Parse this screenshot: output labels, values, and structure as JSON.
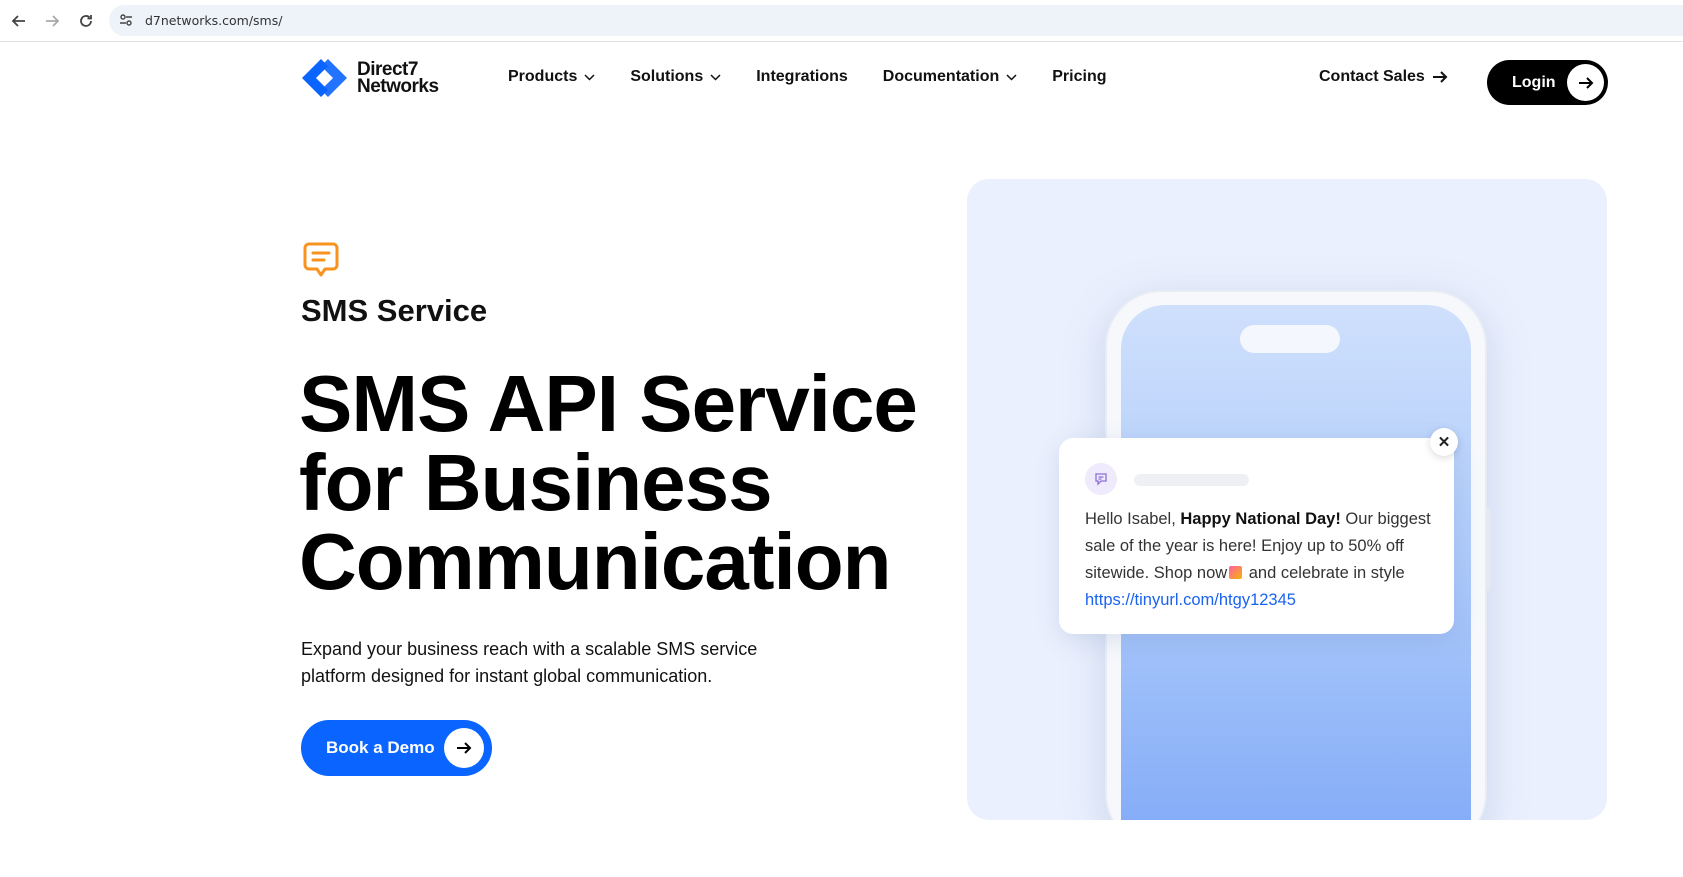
{
  "browser": {
    "url": "d7networks.com/sms/"
  },
  "header": {
    "logo_line1": "Direct7",
    "logo_line2": "Networks",
    "nav": [
      {
        "label": "Products",
        "dropdown": true
      },
      {
        "label": "Solutions",
        "dropdown": true
      },
      {
        "label": "Integrations",
        "dropdown": false
      },
      {
        "label": "Documentation",
        "dropdown": true
      },
      {
        "label": "Pricing",
        "dropdown": false
      }
    ],
    "contact_sales": "Contact Sales",
    "login": "Login"
  },
  "hero": {
    "eyebrow": "SMS Service",
    "headline_line1": "SMS API Service",
    "headline_line2": "for Business",
    "headline_line3": "Communication",
    "subtext": "Expand your business reach with a scalable SMS service platform designed for instant global communication.",
    "cta": "Book a Demo"
  },
  "notification": {
    "greeting": "Hello Isabel, ",
    "highlight": "Happy National Day!",
    "body1": " Our biggest sale of the year is here! Enjoy up to 50% off sitewide. Shop now",
    "body2": " and celebrate in style ",
    "link": "https://tinyurl.com/htgy12345"
  },
  "colors": {
    "brand_blue": "#0a64ff",
    "accent_orange": "#f7931e",
    "illustration_bg": "#eaf0fd",
    "link_blue": "#1a63f0"
  },
  "icons": {
    "sms": "chat-bubble-icon",
    "arrow": "arrow-right-icon",
    "close": "close-icon"
  }
}
